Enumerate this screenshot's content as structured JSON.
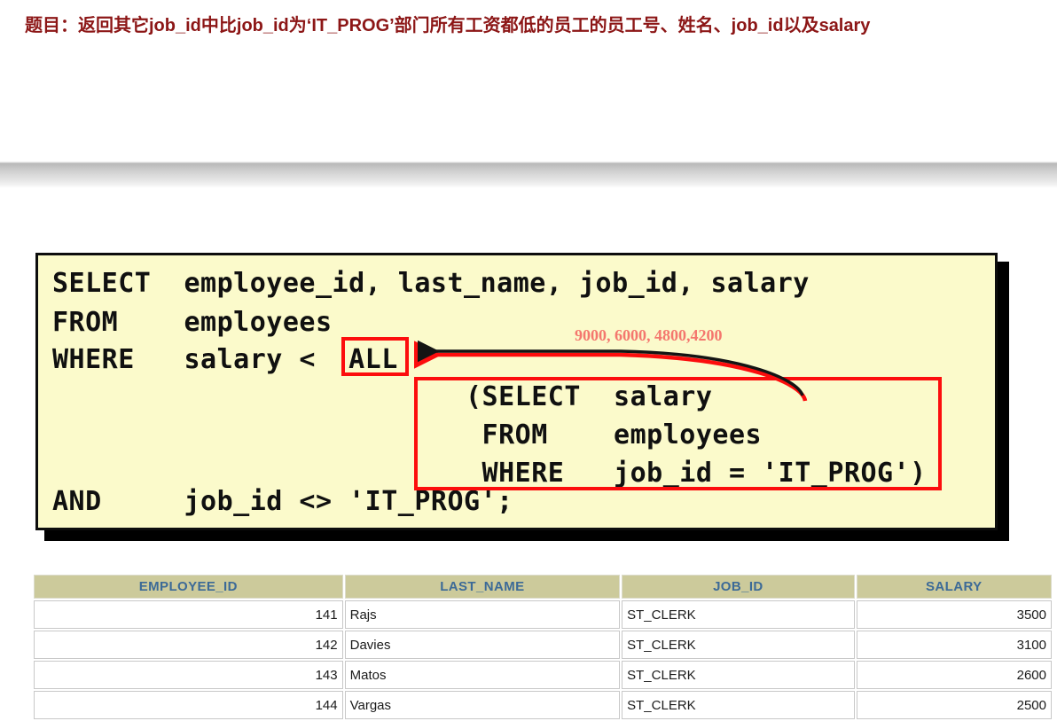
{
  "title": {
    "text": "题目：返回其它job_id中比job_id为‘IT_PROG’部门所有工资都低的员工的员工号、姓名、job_id以及salary",
    "color": "#8c1616"
  },
  "code_block": {
    "background": "#fbfacb",
    "lines": [
      "SELECT  employee_id, last_name, job_id, salary",
      "FROM    employees",
      "WHERE   salary <  ALL",
      "AND     job_id <> 'IT_PROG';"
    ],
    "subquery_lines": [
      "(SELECT  salary",
      " FROM    employees",
      " WHERE   job_id = 'IT_PROG')"
    ],
    "highlight_keyword": "ALL",
    "highlight_color": "#fc0d0d"
  },
  "annotation": {
    "values": "9000, 6000, 4800,4200",
    "color": "#f4776e"
  },
  "results": {
    "columns": [
      "EMPLOYEE_ID",
      "LAST_NAME",
      "JOB_ID",
      "SALARY"
    ],
    "header_bg": "#ccca9b",
    "header_color": "#3c6a97",
    "rows": [
      [
        "141",
        "Rajs",
        "ST_CLERK",
        "3500"
      ],
      [
        "142",
        "Davies",
        "ST_CLERK",
        "3100"
      ],
      [
        "143",
        "Matos",
        "ST_CLERK",
        "2600"
      ],
      [
        "144",
        "Vargas",
        "ST_CLERK",
        "2500"
      ]
    ]
  }
}
